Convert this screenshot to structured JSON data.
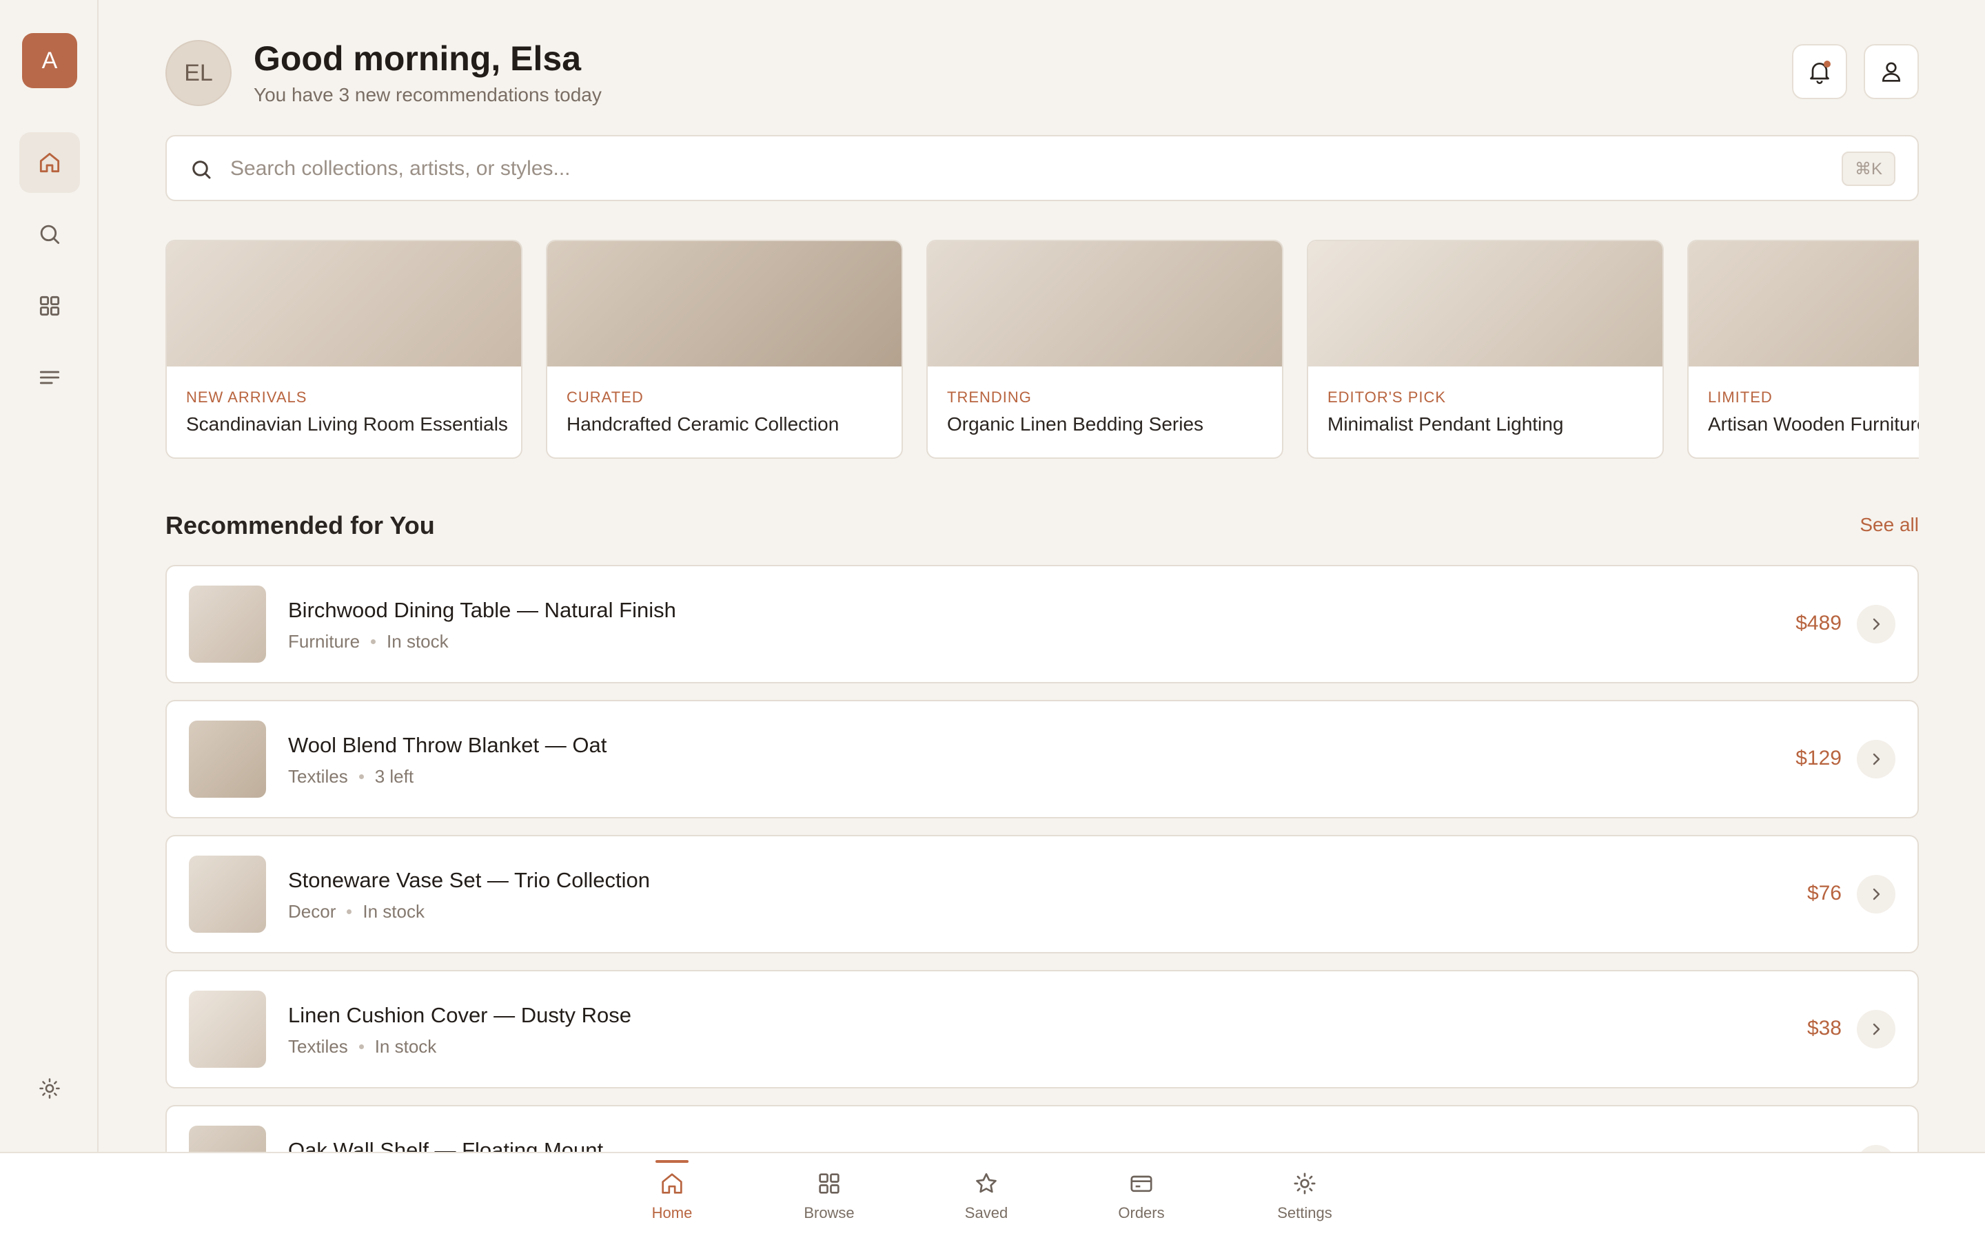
{
  "app": {
    "logo_letter": "A"
  },
  "sidebar": {
    "items": [
      {
        "icon": "home-icon",
        "active": true
      },
      {
        "icon": "search-icon",
        "active": false
      },
      {
        "icon": "grid-icon",
        "active": false
      },
      {
        "icon": "list-icon",
        "active": false
      }
    ],
    "bottom_icon": "sun-icon"
  },
  "header": {
    "avatar_initials": "EL",
    "greeting": "Good morning, Elsa",
    "subtitle": "You have 3 new recommendations today"
  },
  "search": {
    "placeholder": "Search collections, artists, or styles...",
    "shortcut": "⌘K"
  },
  "collections": [
    {
      "tag": "NEW ARRIVALS",
      "title": "Scandinavian Living Room Essentials"
    },
    {
      "tag": "CURATED",
      "title": "Handcrafted Ceramic Collection"
    },
    {
      "tag": "TRENDING",
      "title": "Organic Linen Bedding Series"
    },
    {
      "tag": "EDITOR'S PICK",
      "title": "Minimalist Pendant Lighting"
    },
    {
      "tag": "LIMITED",
      "title": "Artisan Wooden Furniture"
    }
  ],
  "recommended": {
    "title": "Recommended for You",
    "see_all": "See all",
    "items": [
      {
        "name": "Birchwood Dining Table — Natural Finish",
        "category": "Furniture",
        "stock": "In stock",
        "price": "$489"
      },
      {
        "name": "Wool Blend Throw Blanket — Oat",
        "category": "Textiles",
        "stock": "3 left",
        "price": "$129"
      },
      {
        "name": "Stoneware Vase Set — Trio Collection",
        "category": "Decor",
        "stock": "In stock",
        "price": "$76"
      },
      {
        "name": "Linen Cushion Cover — Dusty Rose",
        "category": "Textiles",
        "stock": "In stock",
        "price": "$38"
      },
      {
        "name": "Oak Wall Shelf — Floating Mount",
        "category": "",
        "stock": "",
        "price": ""
      }
    ]
  },
  "bottom_nav": {
    "items": [
      {
        "label": "Home",
        "icon": "home-icon",
        "active": true
      },
      {
        "label": "Browse",
        "icon": "grid-icon",
        "active": false
      },
      {
        "label": "Saved",
        "icon": "star-icon",
        "active": false
      },
      {
        "label": "Orders",
        "icon": "card-icon",
        "active": false
      },
      {
        "label": "Settings",
        "icon": "gear-icon",
        "active": false
      }
    ]
  },
  "colors": {
    "accent": "#b8643f",
    "background": "#f6f3ee",
    "surface": "#ffffff",
    "border": "#e4ddd4"
  }
}
